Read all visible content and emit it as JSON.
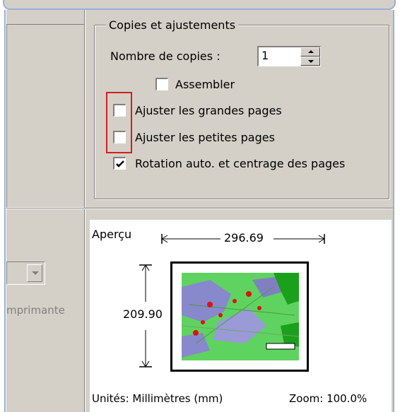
{
  "copies_group": {
    "title": "Copies et ajustements",
    "copies_label": "Nombre de copies :",
    "copies_value": "1",
    "collate_label": "Assembler",
    "collate_checked": false,
    "fit_large_label": "Ajuster les grandes pages",
    "fit_large_checked": false,
    "fit_small_label": "Ajuster les petites pages",
    "fit_small_checked": false,
    "autorotate_label": "Rotation auto. et centrage des pages",
    "autorotate_checked": true
  },
  "left_panel": {
    "printer_label_partial": "mprimante"
  },
  "preview": {
    "title": "Aperçu",
    "width_label": "296.69",
    "height_label": "209.90",
    "units_label": "Unités: Millimètres (mm)",
    "zoom_label": "Zoom: 100.0%"
  },
  "colors": {
    "window_bg": "#d4d0c8",
    "highlight_box": "#d02020",
    "map_green": "#5fd35f",
    "map_purple": "#8888cc",
    "map_red": "#e01010",
    "map_dark_green": "#1aa01a"
  }
}
